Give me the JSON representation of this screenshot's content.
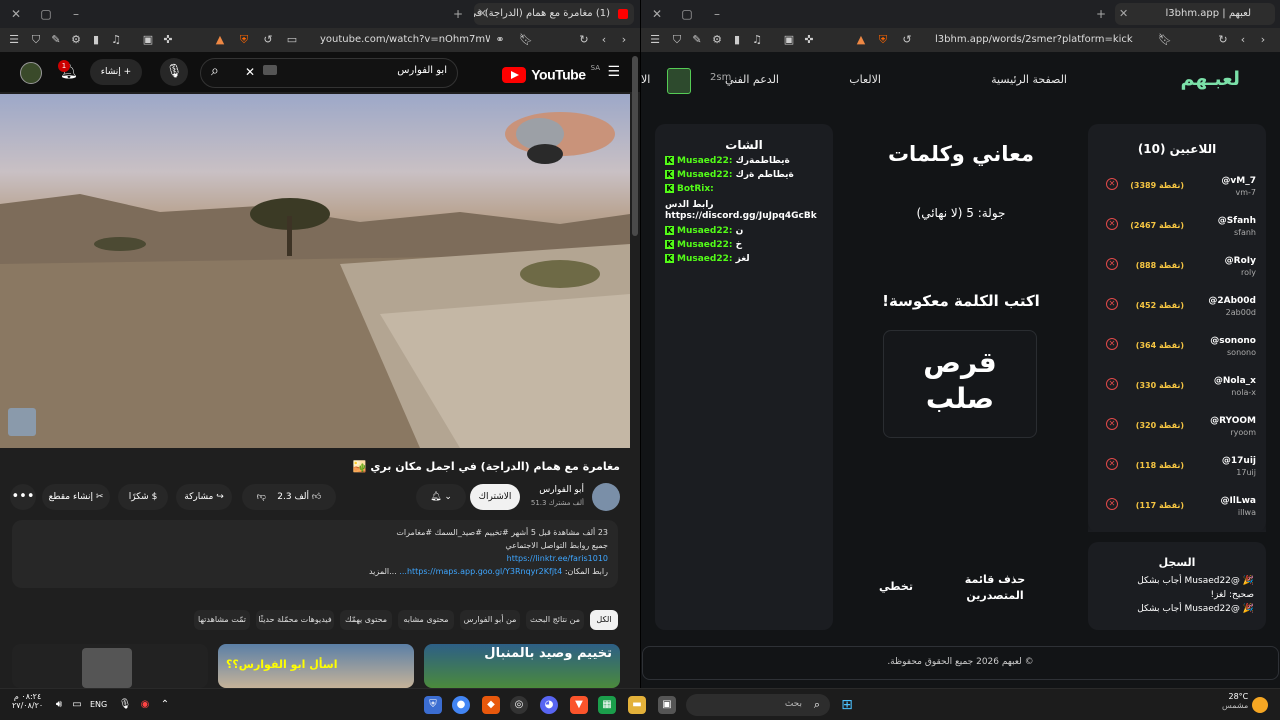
{
  "left_browser": {
    "tab_title": "(1) مغامرة مع همام (الدراجة) في",
    "url": "youtube.com/watch?v=nOhm7mWQUJI"
  },
  "right_browser": {
    "tab_title": "لعبهم | l3bhm.app",
    "url": "l3bhm.app/words/2smer?platform=kick"
  },
  "youtube": {
    "logo_text": "YouTube",
    "country_code": "SA",
    "search_value": "ابو الفوارس",
    "create_label": "إنشاء",
    "notification_count": "1",
    "video_title": "مغامرة مع همام (الدراجة) في اجمل مكان بري 🏜️",
    "channel_name": "أبو الفوارس",
    "subscribers": "51.3 ألف مشترك",
    "subscribe_label": "الاشتراك",
    "likes": "2.3 ألف",
    "share_label": "مشاركة",
    "thanks_label": "شكرًا",
    "clip_label": "إنشاء مقطع",
    "desc_meta": "23 ألف مشاهدة  قبل 5 أشهر  #تخييم #صيد_السمك #مغامرات",
    "desc_line2": "جميع روابط التواصل الاجتماعي",
    "desc_link1": "https://linktr.ee/faris1010",
    "desc_line4_prefix": "رابط المكان:",
    "desc_link2": "https://maps.app.goo.gl/Y3Rnqyr2Kfjt4...",
    "desc_more": "...المزيد",
    "chips": [
      "الكل",
      "من نتائج البحث",
      "من أبو الفوارس",
      "محتوى مشابه",
      "محتوى يهمّك",
      "فيديوهات محمّلة حديثًا",
      "تمّت مشاهدتها"
    ],
    "thumb_text_1": "تخييم وصيد بالمنبال",
    "thumb_text_2": "اسأل ابو الفوارس؟؟"
  },
  "site": {
    "logo": "لعبـهم",
    "nav_home": "الصفحة الرئيسية",
    "nav_games": "الالعاب",
    "nav_support": "الدعم الفني",
    "nav_user": "2sm",
    "nav_cut": "الا",
    "players_title": "اللاعبين (10)",
    "players": [
      {
        "handle": "@vM_7",
        "sub": "vm-7",
        "points": "(3389 نقطة)"
      },
      {
        "handle": "@Sfanh",
        "sub": "sfanh",
        "points": "(2467 نقطة)"
      },
      {
        "handle": "@RoIy",
        "sub": "roly",
        "points": "(888 نقطة)"
      },
      {
        "handle": "@2Ab00d",
        "sub": "2ab00d",
        "points": "(452 نقطة)"
      },
      {
        "handle": "@sonono",
        "sub": "sonono",
        "points": "(364 نقطة)"
      },
      {
        "handle": "@Nola_x",
        "sub": "nola-x",
        "points": "(330 نقطة)"
      },
      {
        "handle": "@RYOOM",
        "sub": "ryoom",
        "points": "(320 نقطة)"
      },
      {
        "handle": "@17uij",
        "sub": "17uij",
        "points": "(118 نقطة)"
      },
      {
        "handle": "@IlLwa",
        "sub": "illwa",
        "points": "(117 نقطة)"
      }
    ],
    "log_title": "السجل",
    "log_lines": [
      "🎉 @Musaed22 أجاب بشكل",
      "صحيح: لغز!",
      "🎉 @Musaed22 أجاب بشكل"
    ],
    "game_title": "معاني وكلمات",
    "round": "جولة: 5 (لا نهائي)",
    "prompt": "اكتب الكلمة معكوسة!",
    "word_line1": "قرص",
    "word_line2": "صلب",
    "btn_remove": "حذف قائمة",
    "btn_remove2": "المتصدرين",
    "btn_skip": "تخطي",
    "chat_title": "الشات",
    "chat": [
      {
        "user": "Musaed22:",
        "msg": "ةيطاطمةرك"
      },
      {
        "user": "Musaed22:",
        "msg": "ةيطاطم ةرك"
      },
      {
        "user": "BotRix:",
        "msg": ""
      }
    ],
    "chat_bot_text1": "رابط الدس",
    "chat_bot_text2": "https://discord.gg/JuJpq4GcBk",
    "chat2": [
      {
        "user": "Musaed22:",
        "msg": "ن"
      },
      {
        "user": "Musaed22:",
        "msg": "خ"
      },
      {
        "user": "Musaed22:",
        "msg": "لغز"
      }
    ],
    "footer": "© لعبهم 2026 جميع الحقوق محفوظة."
  },
  "taskbar": {
    "time": "٠٨:٢٤ م",
    "date": "٢٧/٠٨/٢٠",
    "lang": "ENG",
    "search_placeholder": "بحث",
    "temp": "28°C",
    "weather": "مشمس"
  }
}
